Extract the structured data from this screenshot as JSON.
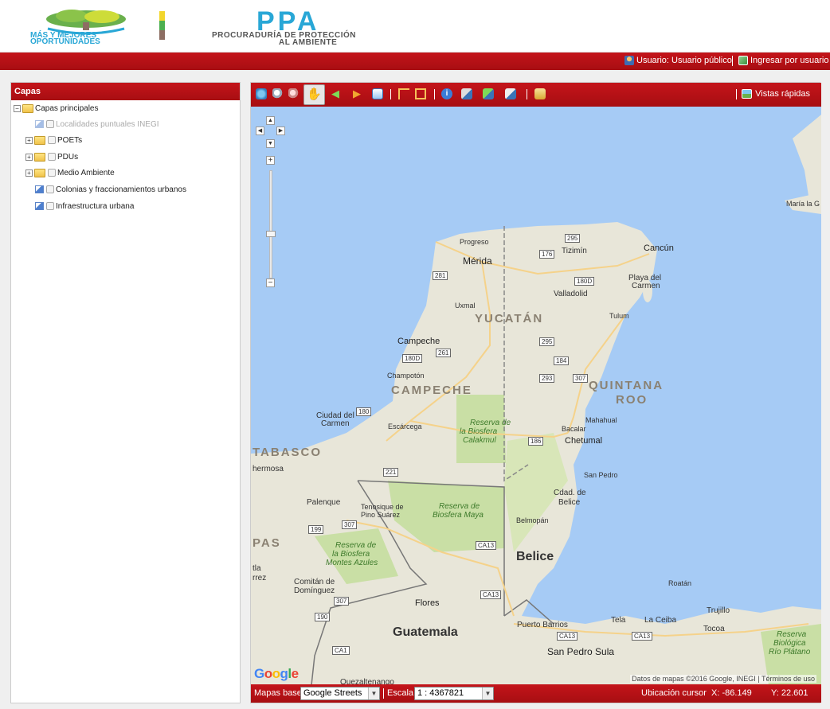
{
  "header": {
    "logo_left_text_1": "MÁS Y MEJORES",
    "logo_left_text_2": "OPORTUNIDADES",
    "ppa_title": "PPA",
    "ppa_subtitle_1": "PROCURADURÍA DE PROTECCIÓN",
    "ppa_subtitle_2": "AL AMBIENTE"
  },
  "userbar": {
    "user_label": "Usuario: Usuario público",
    "login_label": "Ingresar por usuario"
  },
  "layers": {
    "title": "Capas",
    "root_label": "Capas principales",
    "items": [
      {
        "label": "Localidades puntuales INEGI",
        "disabled": true
      },
      {
        "label": "POETs"
      },
      {
        "label": "PDUs"
      },
      {
        "label": "Medio Ambiente"
      },
      {
        "label": "Colonias y fraccionamientos urbanos"
      },
      {
        "label": "Infraestructura urbana"
      }
    ]
  },
  "toolbar": {
    "vistas_label": "Vistas rápidas",
    "tools": [
      "globe-icon",
      "zoom-in-icon",
      "zoom-out-icon",
      "pan-hand-icon",
      "back-arrow-icon",
      "forward-arrow-icon",
      "full-extent-icon",
      "measure-line-icon",
      "crop-icon",
      "info-icon",
      "select-layer-icon",
      "add-layer-icon",
      "remove-layer-icon",
      "print-icon"
    ]
  },
  "map": {
    "labels": {
      "yucatan": "YUCATÁN",
      "campeche_state": "CAMPECHE",
      "quintana": "QUINTANA",
      "roo": "ROO",
      "tabasco": "TABASCO",
      "pas": "PAS",
      "belice": "Belice",
      "guatemala": "Guatemala",
      "merida": "Mérida",
      "progreso": "Progreso",
      "tizimin": "Tizimín",
      "cancun": "Cancún",
      "valladolid": "Valladolid",
      "playa1": "Playa del",
      "playa2": "Carmen",
      "tulum": "Tulum",
      "uxmal": "Uxmal",
      "campeche_city": "Campeche",
      "champoton": "Champotón",
      "escarcega": "Escárcega",
      "cd_carmen1": "Ciudad del",
      "cd_carmen2": "Carmen",
      "hermosa": "hermosa",
      "palenque": "Palenque",
      "tenosique1": "Tenosique de",
      "tenosique2": "Pino Suárez",
      "calakmul1": "Reserva de",
      "calakmul2": "la Biosfera",
      "calakmul3": "Calakmul",
      "maya1": "Reserva de",
      "maya2": "Biosfera Maya",
      "azules1": "Reserva de",
      "azules2": "la Biosfera",
      "azules3": "Montes Azules",
      "mahahual": "Mahahual",
      "bacalar": "Bacalar",
      "chetumal": "Chetumal",
      "san_pedro": "San Pedro",
      "cdad_belice1": "Cdad. de",
      "cdad_belice2": "Belice",
      "belmopan": "Belmopán",
      "roatan": "Roatán",
      "puerto_barrios": "Puerto Barrios",
      "san_pedro_sula": "San Pedro Sula",
      "tela": "Tela",
      "la_ceiba": "La Ceiba",
      "trujillo": "Trujillo",
      "tocoa": "Tocoa",
      "platano1": "Reserva",
      "platano2": "Biológica",
      "platano3": "Río Plátano",
      "comitan1": "Comitán de",
      "comitan2": "Domínguez",
      "quezaltenango": "Quezaltenango",
      "tla": "tla",
      "rrez": "rrez",
      "maria": "María la G",
      "flores": "Flores"
    },
    "shields": [
      "295",
      "176",
      "281",
      "180D",
      "261",
      "180D",
      "295",
      "184",
      "293",
      "307",
      "180",
      "186",
      "221",
      "307",
      "199",
      "307",
      "CA13",
      "CA13",
      "307",
      "190",
      "CA13",
      "CA13",
      "CA1"
    ],
    "attribution": "Datos de mapas ©2016 Google, INEGI | Términos de uso",
    "google": "Google"
  },
  "statusbar": {
    "basemap_label": "Mapas base",
    "basemap_value": "Google Streets",
    "scale_label": "Escala",
    "scale_value": "1 : 4367821",
    "cursor_label": "Ubicación cursor",
    "cursor_x": "X: -86.149",
    "cursor_y": "Y: 22.601"
  },
  "colors": {
    "accent_red": "#b5121b",
    "water": "#a6cbf5",
    "land": "#e8e6d9",
    "reserve": "#c9dfa5"
  }
}
